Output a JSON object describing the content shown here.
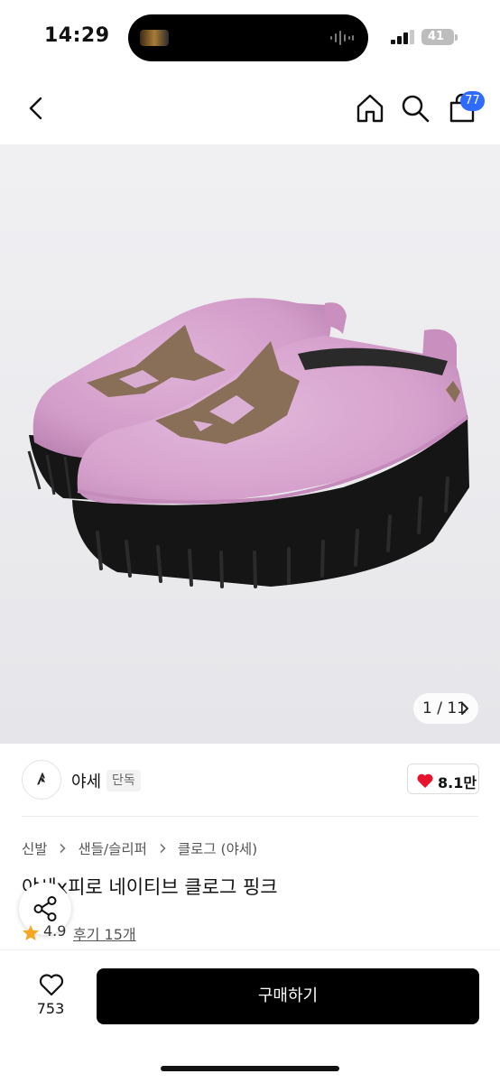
{
  "status_bar": {
    "time": "14:29",
    "battery": "41"
  },
  "nav": {
    "cart_badge": "77"
  },
  "gallery": {
    "indicator": "1 / 11"
  },
  "seller": {
    "avatar_text": "ꤴ",
    "name": "야세",
    "badge": "단독",
    "likes": "8.1만"
  },
  "breadcrumb": [
    "신발",
    "샌들/슬리퍼",
    "클로그 (야세)"
  ],
  "product": {
    "title": "야세x피로 네이티브 클로그 핑크",
    "rating": "4.9",
    "reviews": "후기 15개"
  },
  "bottom_bar": {
    "wish_count": "753",
    "buy_label": "구매하기"
  },
  "colors": {
    "badge_blue": "#2f6bff",
    "heart_red": "#e8132c",
    "star_orange": "#f5a623",
    "buy_black": "#000000",
    "shoe_pink": "#d7a4cf",
    "pattern_brown": "#8a6f58",
    "sole_black": "#161616"
  },
  "icons": [
    "back-arrow-icon",
    "home-icon",
    "search-icon",
    "shopping-bag-icon",
    "chevron-right-icon",
    "heart-icon",
    "share-icon",
    "star-icon"
  ]
}
